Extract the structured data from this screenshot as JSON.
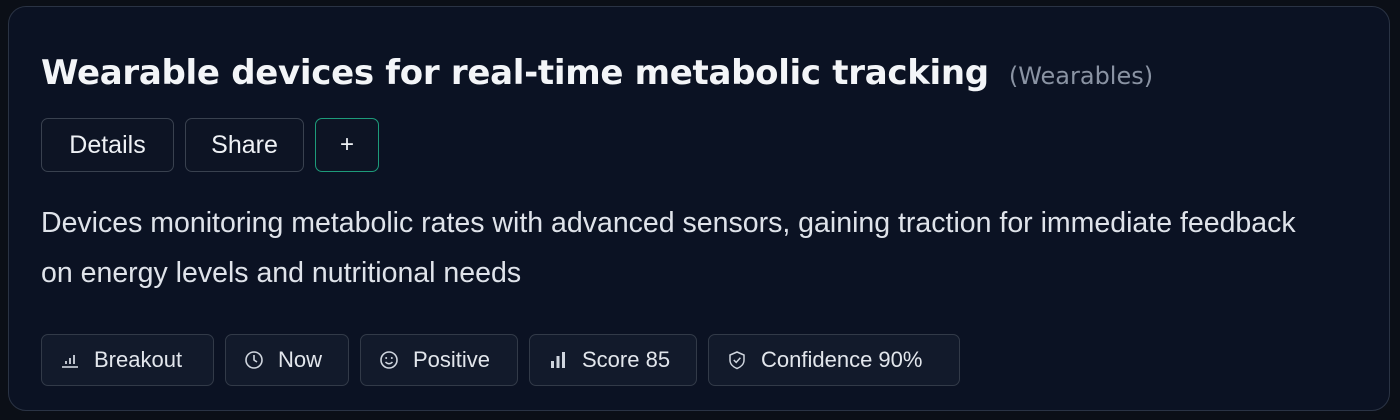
{
  "card": {
    "title": "Wearable devices for real-time metabolic tracking",
    "category": "(Wearables)",
    "description": "Devices monitoring metabolic rates with advanced sensors, gaining traction for immediate feedback on energy levels and nutritional needs"
  },
  "actions": {
    "details_label": "Details",
    "share_label": "Share",
    "add_label": "+"
  },
  "tags": [
    {
      "icon": "bar-chart-icon",
      "label": "Breakout"
    },
    {
      "icon": "clock-icon",
      "label": "Now"
    },
    {
      "icon": "smiley-icon",
      "label": "Positive"
    },
    {
      "icon": "signal-bars-icon",
      "label": "Score 85"
    },
    {
      "icon": "shield-check-icon",
      "label": "Confidence 90%"
    }
  ],
  "colors": {
    "background": "#0b0f17",
    "card": "#0b1223",
    "accent_border": "#1d9b7a",
    "title": "#f3f5f8",
    "muted": "#8a93a3"
  }
}
